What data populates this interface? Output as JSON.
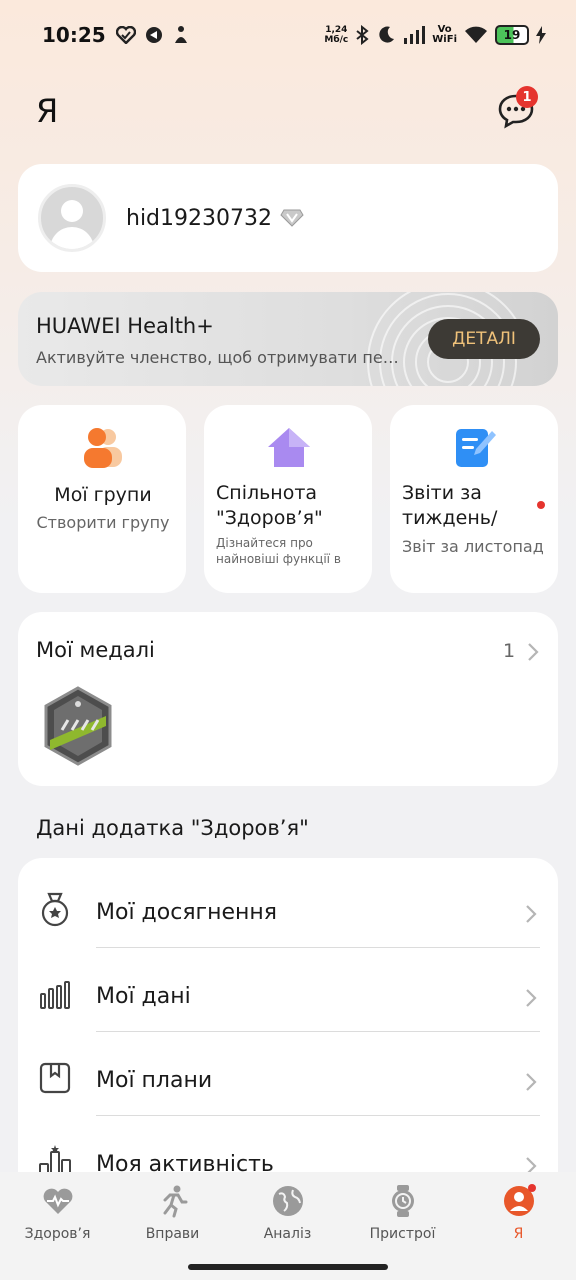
{
  "status_bar": {
    "time": "10:25",
    "net_speed_value": "1,24",
    "net_speed_unit": "Мб/с",
    "volte_top": "Vo",
    "volte_bottom": "WiFi",
    "battery": "19"
  },
  "header": {
    "title": "Я",
    "messages_badge": "1"
  },
  "profile": {
    "username": "hid19230732"
  },
  "health_plus": {
    "title": "HUAWEI Health+",
    "subtitle": "Активуйте членство, щоб отримувати переваги",
    "button": "ДЕТАЛІ"
  },
  "tiles": [
    {
      "title": "Мої групи",
      "subtitle": "Створити групу"
    },
    {
      "title": "Спільнота \"Здоров’я\"",
      "subtitle": "Дізнайтеся про найновіші функції в спільноті"
    },
    {
      "title": "Звіти за тиждень/місяць",
      "subtitle": "Звіт за листопад"
    }
  ],
  "medals": {
    "title": "Мої медалі",
    "count": "1"
  },
  "section": {
    "title": "Дані додатка \"Здоров’я\""
  },
  "list": [
    {
      "label": "Мої досягнення",
      "icon": "medal-icon"
    },
    {
      "label": "Мої дані",
      "icon": "bar-chart-icon"
    },
    {
      "label": "Мої плани",
      "icon": "plan-icon"
    },
    {
      "label": "Моя активність",
      "icon": "activity-icon"
    }
  ],
  "tabbar": [
    {
      "label": "Здоров’я",
      "icon": "heart-icon"
    },
    {
      "label": "Вправи",
      "icon": "running-icon"
    },
    {
      "label": "Аналіз",
      "icon": "globe-icon"
    },
    {
      "label": "Пристрої",
      "icon": "watch-icon"
    },
    {
      "label": "Я",
      "icon": "profile-icon",
      "active": true
    }
  ],
  "colors": {
    "accent": "#e8572a",
    "badge": "#e5342e",
    "details_button_bg": "#3d3a35",
    "details_button_text": "#f0c27a"
  }
}
